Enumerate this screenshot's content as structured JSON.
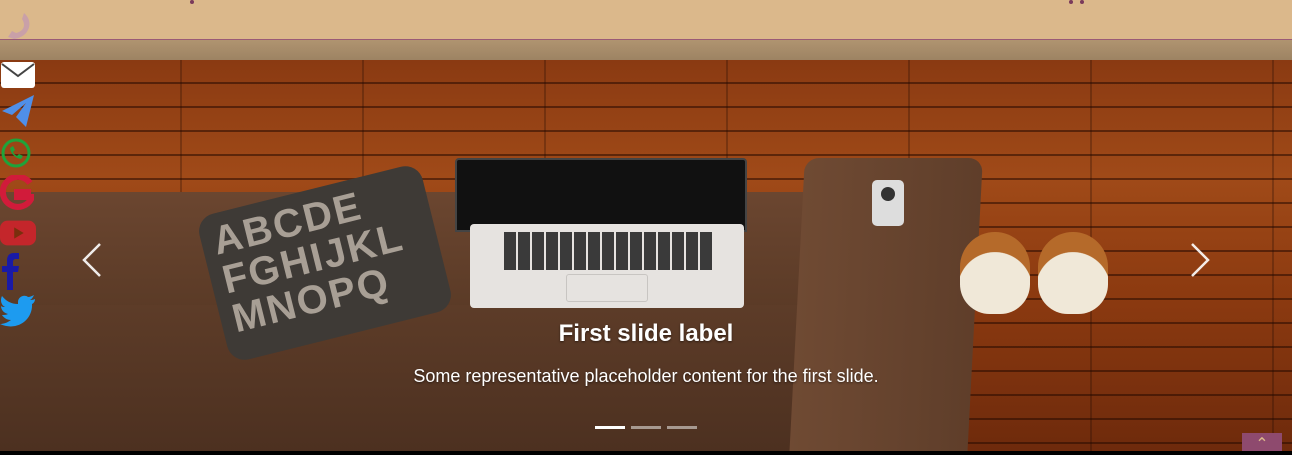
{
  "carousel": {
    "slide_title": "First slide label",
    "slide_text": "Some representative placeholder content for the first slide.",
    "prev_icon": "chevron-left-icon",
    "next_icon": "chevron-right-icon",
    "indicators": 3,
    "active_indicator": 1,
    "pillow_text": "ABCDE FGHIJKL MNOPQ"
  },
  "social": {
    "items": [
      {
        "name": "phone-icon",
        "color": "#c9a0a8"
      },
      {
        "name": "email-icon",
        "color": "#ffffff"
      },
      {
        "name": "telegram-icon",
        "color": "#4f8fe8"
      },
      {
        "name": "whatsapp-icon",
        "color": "#1fa33a"
      },
      {
        "name": "google-icon",
        "color": "#d11b3a"
      },
      {
        "name": "youtube-icon",
        "color": "#c4262b"
      },
      {
        "name": "facebook-icon",
        "color": "#1a1aa6"
      },
      {
        "name": "twitter-icon",
        "color": "#1d9bf0"
      }
    ]
  },
  "back_to_top": {
    "icon": "chevron-up-icon",
    "symbol": "⌃"
  },
  "colors": {
    "header_bg": "#dbb88b",
    "accent": "#8e4a6e"
  }
}
